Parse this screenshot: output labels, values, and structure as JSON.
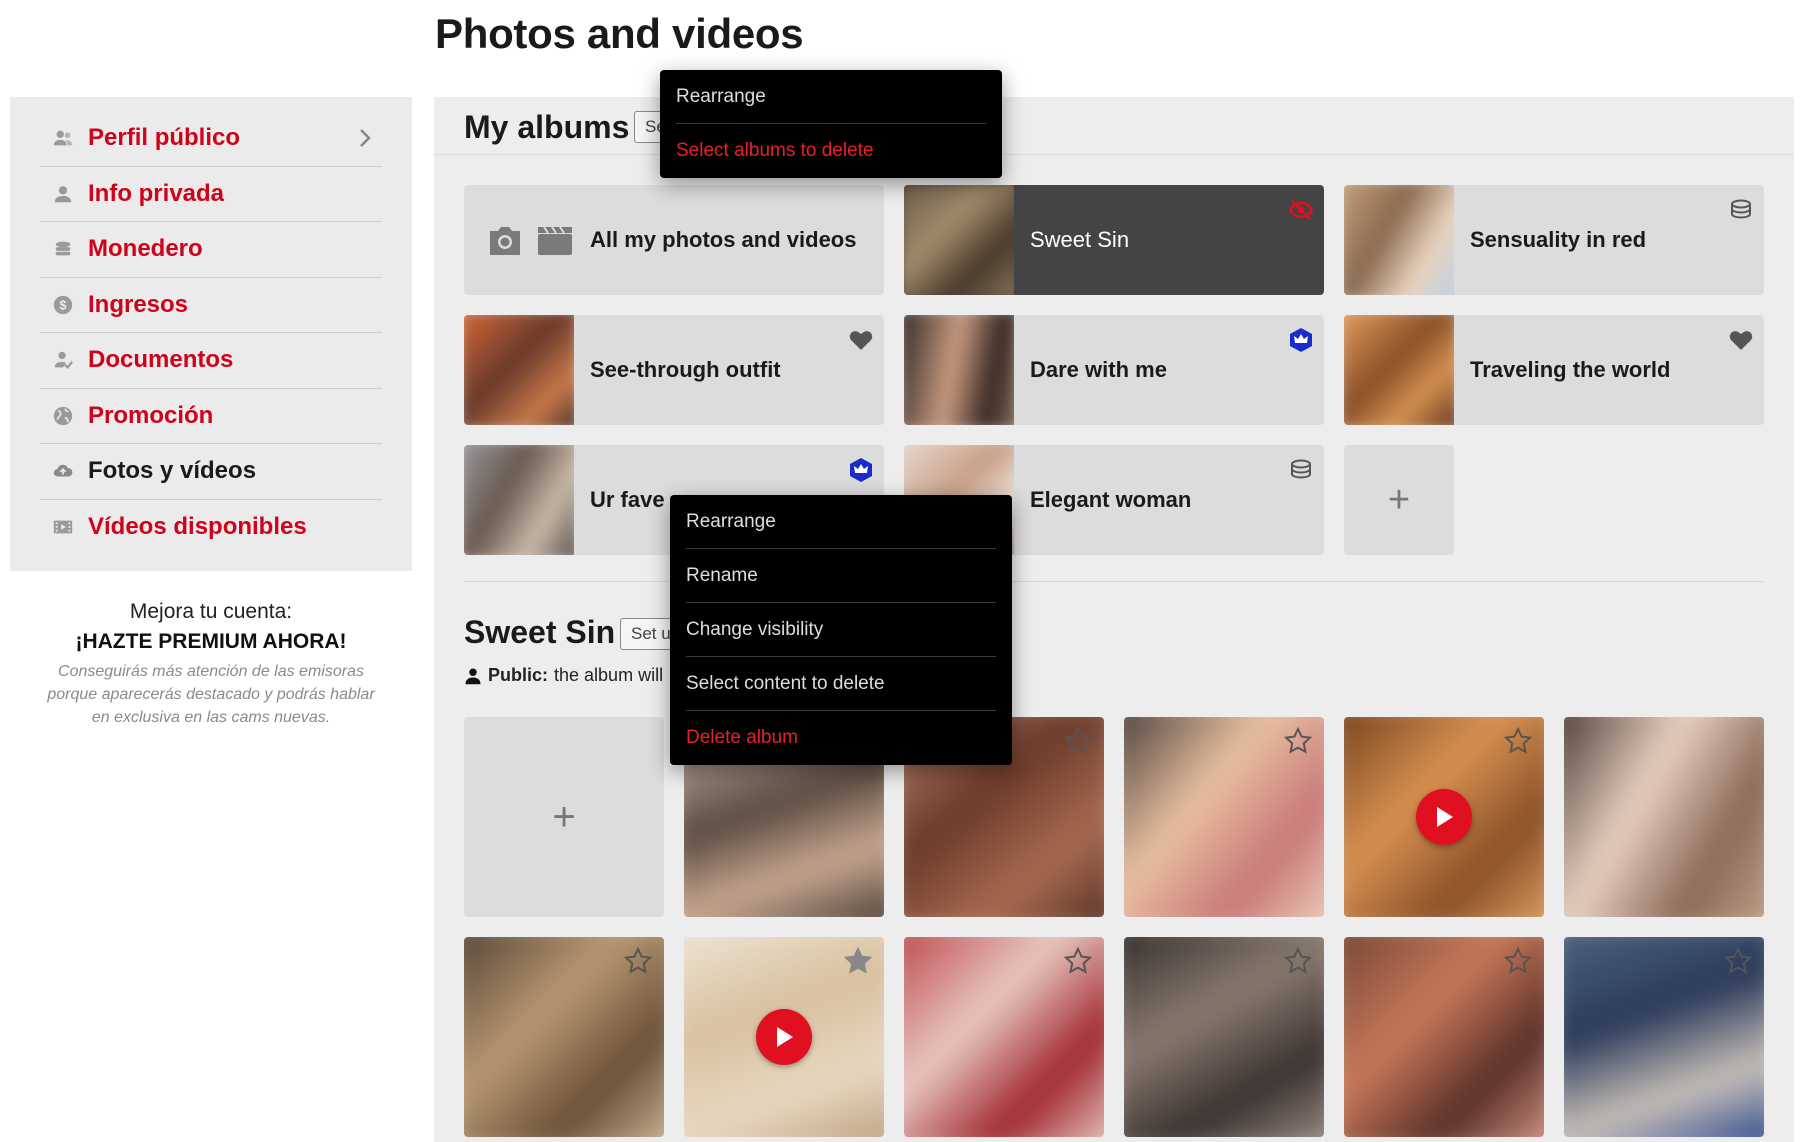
{
  "page": {
    "title": "Photos and videos"
  },
  "sidebar": {
    "items": [
      {
        "label": "Perfil público",
        "icon": "users-icon",
        "active": false
      },
      {
        "label": "Info privada",
        "icon": "user-icon",
        "active": false
      },
      {
        "label": "Monedero",
        "icon": "coins-icon",
        "active": false
      },
      {
        "label": "Ingresos",
        "icon": "dollar-icon",
        "active": false
      },
      {
        "label": "Documentos",
        "icon": "user-check-icon",
        "active": false
      },
      {
        "label": "Promoción",
        "icon": "globe-icon",
        "active": false
      },
      {
        "label": "Fotos y vídeos",
        "icon": "cloud-icon",
        "active": true
      },
      {
        "label": "Vídeos disponibles",
        "icon": "film-icon",
        "active": false
      }
    ],
    "chevron_icon": "chevron-right-icon"
  },
  "premium": {
    "line1": "Mejora tu cuenta:",
    "line2": "¡HAZTE PREMIUM AHORA!",
    "desc": "Conseguirás más atención de las emisoras porque aparecerás destacado y podrás hablar en exclusiva en las cams nuevas."
  },
  "albums_section": {
    "title": "My albums",
    "button_label": "Se",
    "albums": [
      {
        "name": "All my photos and videos",
        "badge": ""
      },
      {
        "name": "Sweet Sin",
        "badge": "eye-slash-icon"
      },
      {
        "name": "Sensuality in red",
        "badge": "coins-icon"
      },
      {
        "name": "See-through outfit",
        "badge": "heart-icon"
      },
      {
        "name": "Dare with me",
        "badge": "crown-icon"
      },
      {
        "name": "Traveling the world",
        "badge": "heart-icon"
      },
      {
        "name": "Ur fave sex",
        "badge": "crown-icon"
      },
      {
        "name": "Elegant woman",
        "badge": "coins-icon"
      }
    ],
    "add_label": "+"
  },
  "album_detail": {
    "title": "Sweet Sin",
    "button_label": "Set u",
    "visibility_label": "Public:",
    "visibility_text": "the album will",
    "add_label": "+"
  },
  "menu_top": {
    "items": [
      {
        "label": "Rearrange",
        "danger": false
      },
      {
        "label": "Select albums to delete",
        "danger": true
      }
    ]
  },
  "menu_album": {
    "items": [
      {
        "label": "Rearrange",
        "danger": false
      },
      {
        "label": "Rename",
        "danger": false
      },
      {
        "label": "Change visibility",
        "danger": false
      },
      {
        "label": "Select content to delete",
        "danger": false
      },
      {
        "label": "Delete album",
        "danger": true
      }
    ]
  },
  "colors": {
    "accent": "#d0021b",
    "menu_bg": "#000000",
    "danger_text": "#e8202a",
    "crown_badge": "#1a2bc9",
    "play_button": "#e01020"
  }
}
